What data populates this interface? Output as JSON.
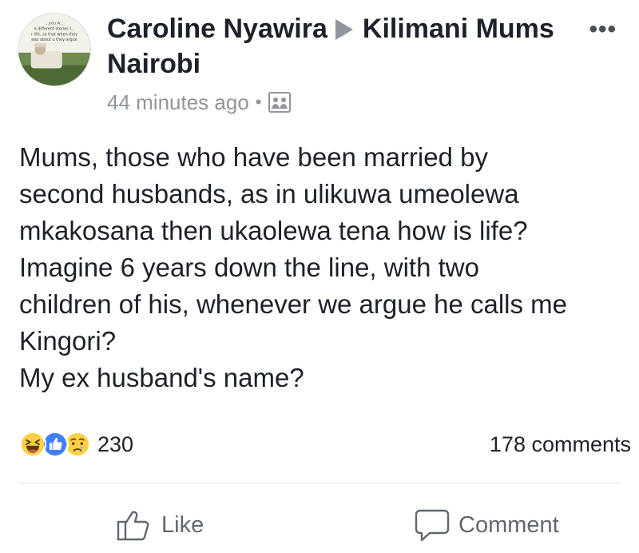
{
  "post": {
    "author": "Caroline Nyawira",
    "group": "Kilimani Mums Nairobi",
    "timestamp": "44 minutes ago",
    "separator": "•",
    "more_label": "•••",
    "avatar_text": [
      "...you w...",
      "a different stories l...",
      "r life, so that when they",
      "eep about u they argue"
    ],
    "body_lines": [
      "Mums, those who have been married by",
      "second husbands, as in ulikuwa umeolewa",
      "mkakosana then ukaolewa tena how is life?",
      "Imagine 6 years down the line, with two",
      "children of his, whenever we argue he calls me",
      "Kingori?",
      "My ex husband's name?"
    ]
  },
  "reactions": {
    "icons": [
      "haha-icon",
      "like-icon",
      "sad-icon"
    ],
    "count": "230",
    "comments": "178 comments"
  },
  "actions": {
    "like_label": "Like",
    "comment_label": "Comment"
  },
  "colors": {
    "text": "#1d2129",
    "meta": "#90949c",
    "like_blue": "#4080ff",
    "reaction_yellow": "#ffd045",
    "action_gray": "#616770"
  }
}
